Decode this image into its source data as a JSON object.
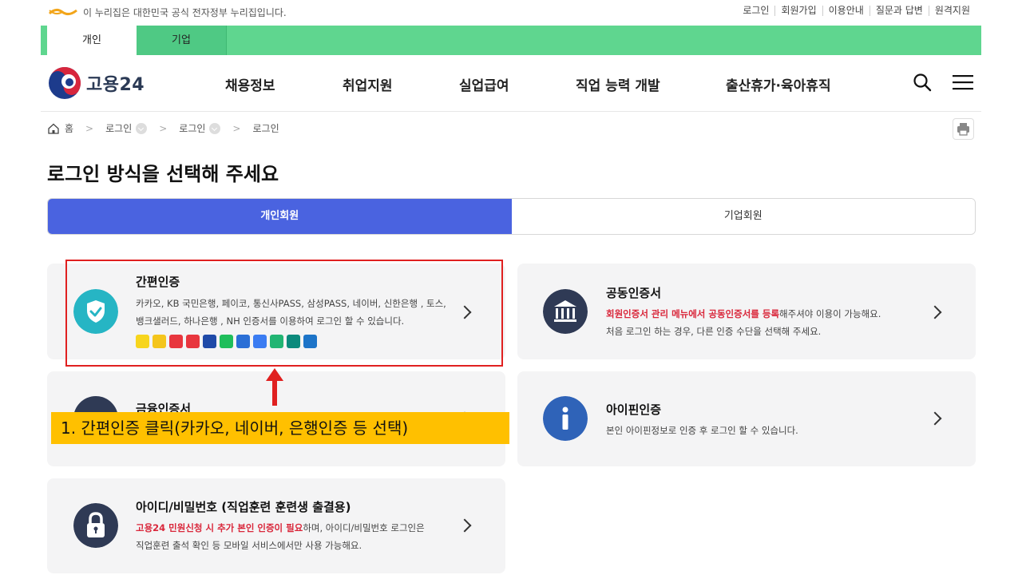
{
  "topbar": {
    "gov_notice": "이 누리집은 대한민국 공식 전자정부 누리집입니다.",
    "links": [
      "로그인",
      "회원가입",
      "이용안내",
      "질문과 답변",
      "원격지원"
    ]
  },
  "tabs": {
    "personal": "개인",
    "company": "기업"
  },
  "header": {
    "brand": "고용24",
    "nav": [
      "채용정보",
      "취업지원",
      "실업급여",
      "직업 능력 개발",
      "출산휴가·육아휴직"
    ]
  },
  "breadcrumb": {
    "home": "홈",
    "level1": "로그인",
    "level2": "로그인",
    "current": "로그인"
  },
  "page_title": "로그인 방식을 선택해 주세요",
  "member_type": {
    "personal": "개인회원",
    "company": "기업회원"
  },
  "cards": {
    "simple_auth": {
      "title": "간편인증",
      "line1": "카카오, KB 국민은행, 페이코, 통신사PASS, 삼성PASS, 네이버, 신한은행 , 토스,",
      "line2": "뱅크샐러드, 하나은행 , NH 인증서를 이용하여 로그인 할 수 있습니다."
    },
    "joint_cert": {
      "title": "공동인증서",
      "line1_highlight": "회원인증서 관리 메뉴에서 공동인증서를 등록",
      "line1_rest": "해주셔야 이용이 가능해요.",
      "line2": "처음 로그인 하는 경우, 다른 인증 수단을 선택해 주세요."
    },
    "financial_cert": {
      "title": "금융인증서"
    },
    "ipin": {
      "title": "아이핀인증",
      "desc": "본인 아이핀정보로 인증 후 로그인 할 수 있습니다."
    },
    "id_password": {
      "title": "아이디/비밀번호 (직업훈련 훈련생 출결용)",
      "line1_highlight": "고용24 민원신청 시 추가 본인 인증이 필요",
      "line1_rest": "하며, 아이디/비밀번호 로그인은",
      "line2": "직업훈련 출석 확인 등 모바일 서비스에서만 사용 가능해요."
    }
  },
  "auth_badges": [
    {
      "name": "kakao-badge-icon",
      "color": "#f7d51d"
    },
    {
      "name": "kb-badge-icon",
      "color": "#f4c51c"
    },
    {
      "name": "payco-badge-icon",
      "color": "#e8363e"
    },
    {
      "name": "pass-badge-icon",
      "color": "#e8363e"
    },
    {
      "name": "samsung-pass-badge-icon",
      "color": "#1f4aa8"
    },
    {
      "name": "naver-badge-icon",
      "color": "#1fbe5b"
    },
    {
      "name": "shinhan-badge-icon",
      "color": "#2b6fd6"
    },
    {
      "name": "toss-badge-icon",
      "color": "#3b7cf2"
    },
    {
      "name": "banksalad-badge-icon",
      "color": "#22b573"
    },
    {
      "name": "hana-badge-icon",
      "color": "#0c8a7c"
    },
    {
      "name": "nh-badge-icon",
      "color": "#1d74c8"
    }
  ],
  "annotation": {
    "callout": "1. 간편인증 클릭(카카오, 네이버, 은행인증 등 선택)"
  }
}
